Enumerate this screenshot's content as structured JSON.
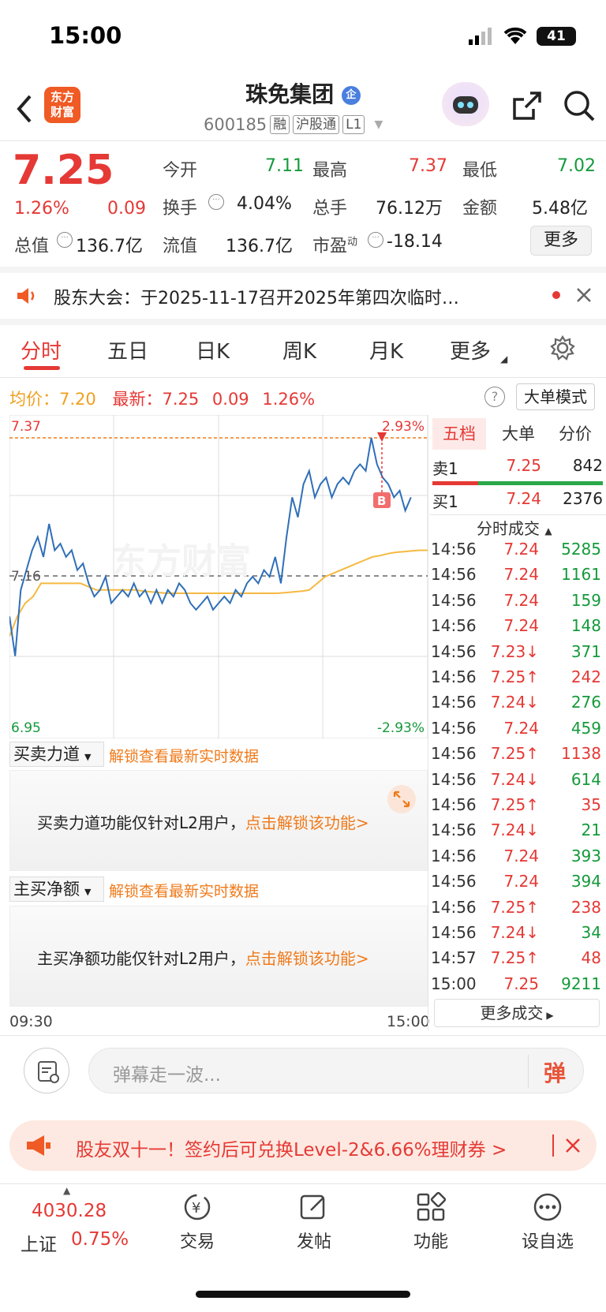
{
  "status_bar": {
    "time": "15:00",
    "battery": "41"
  },
  "header": {
    "logo_text_1": "东方",
    "logo_text_2": "财富",
    "stock_name": "珠免集团",
    "badge": "企",
    "code": "600185",
    "tags": [
      "融",
      "沪股通",
      "L1"
    ]
  },
  "quote": {
    "price": "7.25",
    "change_pct": "1.26%",
    "change": "0.09",
    "labels": {
      "open": "今开",
      "high": "最高",
      "low": "最低",
      "turnover": "换手",
      "volume": "总手",
      "amount": "金额",
      "mktcap": "总值",
      "float": "流值",
      "pe": "市盈",
      "pe_sup": "动"
    },
    "values": {
      "open": "7.11",
      "high": "7.37",
      "low": "7.02",
      "turnover": "4.04%",
      "volume": "76.12万",
      "amount": "5.48亿",
      "mktcap": "136.7亿",
      "float": "136.7亿",
      "pe": "-18.14"
    },
    "more_button": "更多"
  },
  "notice": {
    "text": "股东大会：于2025-11-17召开2025年第四次临时…"
  },
  "tabs": [
    "分时",
    "五日",
    "日K",
    "周K",
    "月K",
    "更多"
  ],
  "intraday": {
    "avg_label": "均价：",
    "avg": "7.20",
    "latest_label": "最新：",
    "latest": "7.25",
    "chg": "0.09",
    "pct": "1.26%",
    "big_order_button": "大单模式",
    "y_top": "7.37",
    "y_mid": "7.16",
    "y_bottom": "6.95",
    "pct_top": "2.93%",
    "pct_bottom": "-2.93%",
    "marker": "B",
    "time_start": "09:30",
    "time_end": "15:00",
    "watermark": "东方财富"
  },
  "chart_data": {
    "type": "line",
    "ylim": [
      6.95,
      7.37
    ],
    "x_range": [
      "09:30",
      "15:00"
    ],
    "series": [
      {
        "values": [
          7.1,
          7.04,
          7.14,
          7.17,
          7.2,
          7.22,
          7.19,
          7.24,
          7.2,
          7.21,
          7.19,
          7.2,
          7.17,
          7.18,
          7.15,
          7.13,
          7.14,
          7.16,
          7.12,
          7.13,
          7.14,
          7.13,
          7.15,
          7.13,
          7.14,
          7.12,
          7.14,
          7.12,
          7.14,
          7.13,
          7.15,
          7.14,
          7.12,
          7.11,
          7.12,
          7.13,
          7.11,
          7.12,
          7.13,
          7.12,
          7.14,
          7.13,
          7.15,
          7.16,
          7.15,
          7.17,
          7.16,
          7.19,
          7.15,
          7.22,
          7.28,
          7.25,
          7.3,
          7.32,
          7.28,
          7.3,
          7.31,
          7.28,
          7.3,
          7.31,
          7.3,
          7.32,
          7.33,
          7.32,
          7.37,
          7.33,
          7.31,
          7.3,
          7.28,
          7.29,
          7.26,
          7.28
        ]
      },
      {
        "values": [
          7.07,
          7.1,
          7.12,
          7.13,
          7.15,
          7.15,
          7.15,
          7.15,
          7.15,
          7.15,
          7.145,
          7.14,
          7.14,
          7.14,
          7.14,
          7.14,
          7.14,
          7.138,
          7.137,
          7.136,
          7.135,
          7.135,
          7.135,
          7.135,
          7.135,
          7.135,
          7.135,
          7.135,
          7.135,
          7.135,
          7.135,
          7.135,
          7.135,
          7.135,
          7.135,
          7.136,
          7.137,
          7.138,
          7.14,
          7.15,
          7.16,
          7.165,
          7.17,
          7.175,
          7.18,
          7.185,
          7.19,
          7.192,
          7.195,
          7.197,
          7.198,
          7.199,
          7.2,
          7.2
        ]
      }
    ]
  },
  "order_book": {
    "tabs": [
      "五档",
      "大单",
      "分价"
    ],
    "sell_label": "卖1",
    "sell_price": "7.25",
    "sell_vol": "842",
    "buy_label": "买1",
    "buy_price": "7.24",
    "buy_vol": "2376",
    "sell_ratio": 0.27
  },
  "trades": {
    "title": "分时成交",
    "more": "更多成交",
    "rows": [
      [
        "14:56",
        "7.24",
        "5285",
        ""
      ],
      [
        "14:56",
        "7.24",
        "1161",
        ""
      ],
      [
        "14:56",
        "7.24",
        "159",
        ""
      ],
      [
        "14:56",
        "7.24",
        "148",
        ""
      ],
      [
        "14:56",
        "7.23",
        "371",
        "down"
      ],
      [
        "14:56",
        "7.25",
        "242",
        "up"
      ],
      [
        "14:56",
        "7.24",
        "276",
        "down"
      ],
      [
        "14:56",
        "7.24",
        "459",
        ""
      ],
      [
        "14:56",
        "7.25",
        "1138",
        "up"
      ],
      [
        "14:56",
        "7.24",
        "614",
        "down"
      ],
      [
        "14:56",
        "7.25",
        "35",
        "up"
      ],
      [
        "14:56",
        "7.24",
        "21",
        "down"
      ],
      [
        "14:56",
        "7.24",
        "393",
        ""
      ],
      [
        "14:56",
        "7.24",
        "394",
        ""
      ],
      [
        "14:56",
        "7.25",
        "238",
        "up"
      ],
      [
        "14:56",
        "7.24",
        "34",
        "down"
      ],
      [
        "14:57",
        "7.25",
        "48",
        "up"
      ],
      [
        "15:00",
        "7.25",
        "9211",
        ""
      ]
    ]
  },
  "panels": {
    "p1_title": "买卖力道",
    "p1_unlock": "解锁查看最新实时数据",
    "p1_msg": "买卖力道功能仅针对L2用户，",
    "p1_link": "点击解锁该功能>",
    "p2_title": "主买净额",
    "p2_unlock": "解锁查看最新实时数据",
    "p2_msg": "主买净额功能仅针对L2用户，",
    "p2_link": "点击解锁该功能>"
  },
  "comment": {
    "placeholder": "弹幕走一波...",
    "danmu_button": "弹"
  },
  "promo": {
    "text": "股友双十一！签约后可兑换Level-2&6.66%理财券 >"
  },
  "bottom_nav": {
    "index_value": "4030.28",
    "index_name": "上证",
    "index_pct": "0.75%",
    "items": [
      "交易",
      "发帖",
      "功能",
      "设自选"
    ]
  },
  "colors": {
    "red": "#e53935",
    "green": "#159a3b",
    "orange": "#f07a1a",
    "price_line": "#2f6fb8",
    "avg_line": "#f5b940"
  }
}
